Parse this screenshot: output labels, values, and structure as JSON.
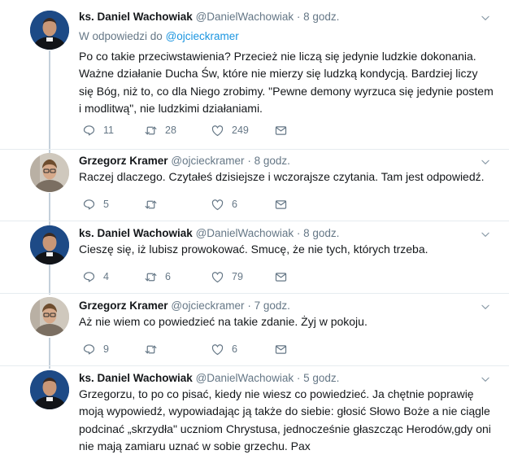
{
  "tweets": [
    {
      "author": "ks. Daniel Wachowiak",
      "handle": "@DanielWachowiak",
      "dot": "·",
      "time": "8 godz.",
      "reply_prefix": "W odpowiedzi do",
      "reply_handle": "@ojcieckramer",
      "text": "Po co takie przeciwstawienia? Przecież nie liczą się jedynie ludzkie dokonania. Ważne działanie Ducha Św, które nie mierzy się ludzką kondycją. Bardziej liczy się Bóg, niż to, co dla Niego zrobimy. \"Pewne demony wyrzuca się jedynie postem i modlitwą\", nie ludzkimi działaniami.",
      "replies": "11",
      "retweets": "28",
      "likes": "249"
    },
    {
      "author": "Grzegorz Kramer",
      "handle": "@ojcieckramer",
      "dot": "·",
      "time": "8 godz.",
      "text": "Raczej dlaczego. Czytałeś dzisiejsze i wczorajsze czytania. Tam jest odpowiedź.",
      "replies": "5",
      "retweets": "",
      "likes": "6"
    },
    {
      "author": "ks. Daniel Wachowiak",
      "handle": "@DanielWachowiak",
      "dot": "·",
      "time": "8 godz.",
      "text": "Cieszę się, iż lubisz prowokować. Smucę, że nie tych, których trzeba.",
      "replies": "4",
      "retweets": "6",
      "likes": "79"
    },
    {
      "author": "Grzegorz Kramer",
      "handle": "@ojcieckramer",
      "dot": "·",
      "time": "7 godz.",
      "text": "Aż nie wiem co powiedzieć na takie zdanie. Żyj w pokoju.",
      "replies": "9",
      "retweets": "",
      "likes": "6"
    },
    {
      "author": "ks. Daniel Wachowiak",
      "handle": "@DanielWachowiak",
      "dot": "·",
      "time": "5 godz.",
      "text": "Grzegorzu, to po co pisać, kiedy nie wiesz co powiedzieć. Ja chętnie poprawię moją wypowiedź, wypowiadając ją także do siebie: głosić Słowo Boże a nie ciągle podcinać „skrzydła\" uczniom Chrystusa, jednocześnie głaszcząc Herodów,gdy oni nie mają zamiaru uznać w sobie grzechu. Pax"
    }
  ],
  "icons": {
    "reply": "reply-icon",
    "retweet": "retweet-icon",
    "like": "heart-icon",
    "dm": "envelope-icon",
    "more": "chevron-down-icon"
  },
  "colors": {
    "text": "#14171a",
    "muted": "#657786",
    "link": "#1b95e0",
    "thread_line": "#c4d0db",
    "separator": "#e6ecf0"
  }
}
